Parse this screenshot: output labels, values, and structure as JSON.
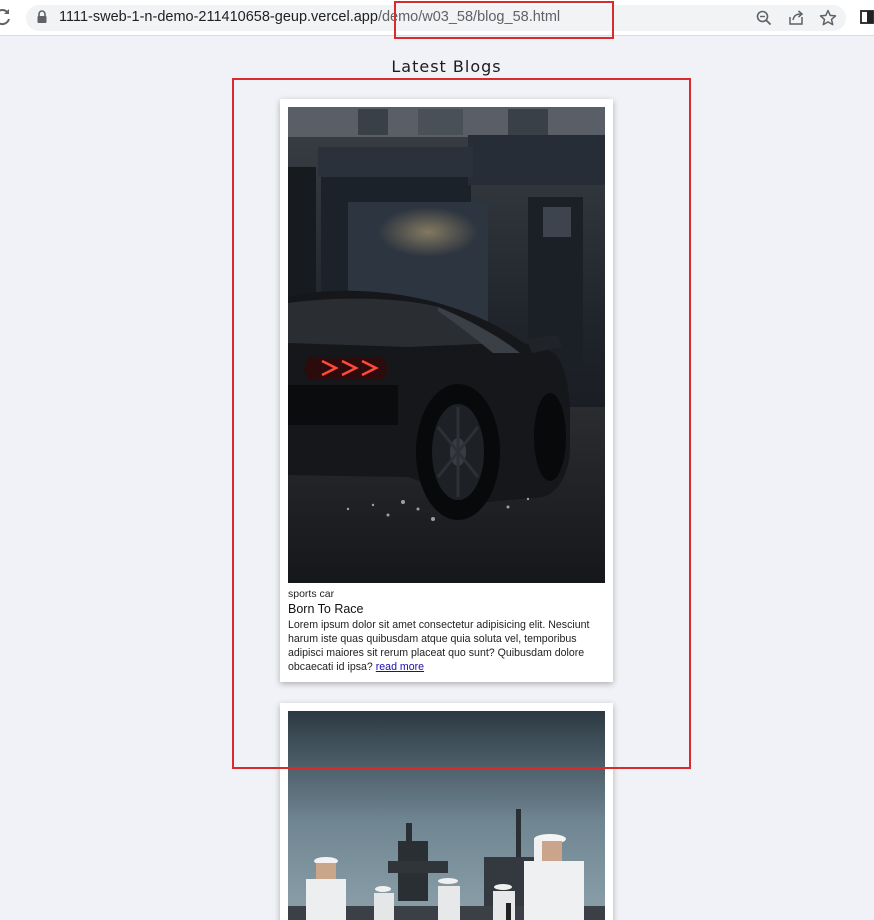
{
  "browser": {
    "url_host": "1111-sweb-1-n-demo-211410658-geup.vercel.app",
    "url_path": "/demo/w03_58/blog_58.html",
    "icons": [
      "reload-icon",
      "lock-icon",
      "zoom-icon",
      "share-icon",
      "star-icon",
      "side-panel-icon"
    ]
  },
  "page": {
    "heading": "Latest Blogs"
  },
  "blogs": [
    {
      "image": "sports-car-photo",
      "category": "sports car",
      "title": "Born To Race",
      "text": "Lorem ipsum dolor sit amet consectetur adipisicing elit. Nesciunt harum iste quas quibusdam atque quia soluta vel, temporibus adipisci maiores sit rerum placeat quo sunt? Quibusdam dolore obcaecati id ipsa?",
      "link": "read more"
    },
    {
      "image": "navy-sailors-photo"
    }
  ],
  "colors": {
    "background": "#f0f2f7",
    "annotation": "#d92b2b",
    "link": "#1a0dab"
  }
}
